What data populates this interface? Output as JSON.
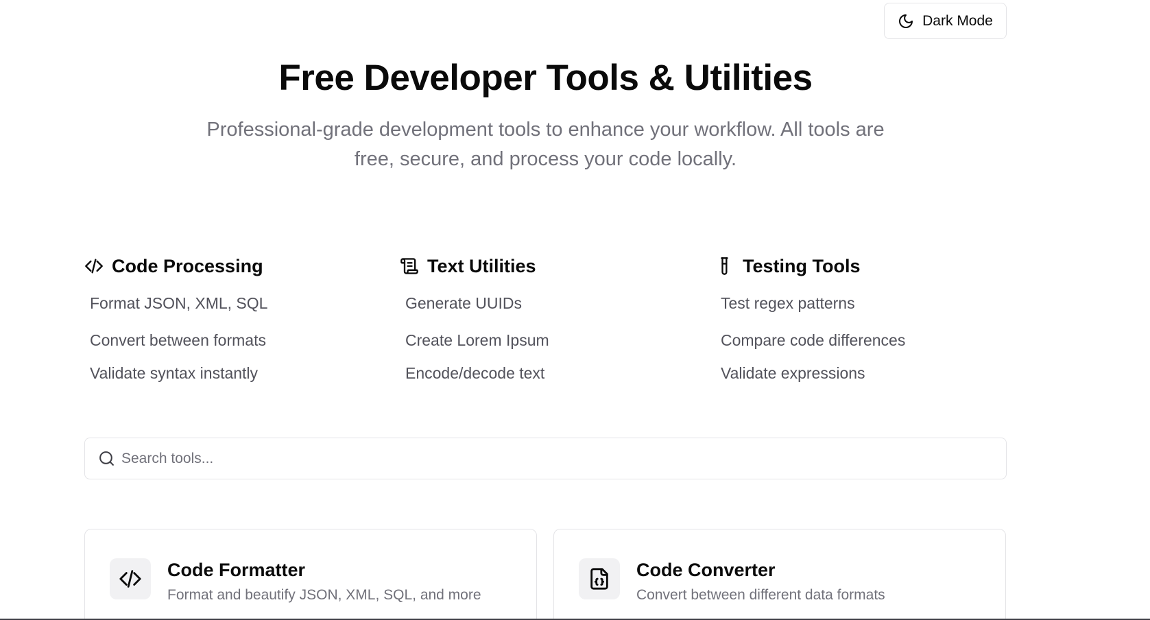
{
  "header": {
    "dark_mode_label": "Dark Mode"
  },
  "hero": {
    "title": "Free Developer Tools & Utilities",
    "subtitle": "Professional-grade development tools to enhance your workflow. All tools are free, secure, and process your code locally."
  },
  "features": [
    {
      "icon": "code-icon",
      "title": "Code Processing",
      "items": [
        "Format JSON, XML, SQL",
        "Convert between formats",
        "Validate syntax instantly"
      ]
    },
    {
      "icon": "scroll-icon",
      "title": "Text Utilities",
      "items": [
        "Generate UUIDs",
        "Create Lorem Ipsum",
        "Encode/decode text"
      ]
    },
    {
      "icon": "test-tube-icon",
      "title": "Testing Tools",
      "items": [
        "Test regex patterns",
        "Compare code differences",
        "Validate expressions"
      ]
    }
  ],
  "search": {
    "placeholder": "Search tools...",
    "value": ""
  },
  "tools": [
    {
      "icon": "code-icon",
      "title": "Code Formatter",
      "description": "Format and beautify JSON, XML, SQL, and more"
    },
    {
      "icon": "file-json-icon",
      "title": "Code Converter",
      "description": "Convert between different data formats"
    }
  ]
}
